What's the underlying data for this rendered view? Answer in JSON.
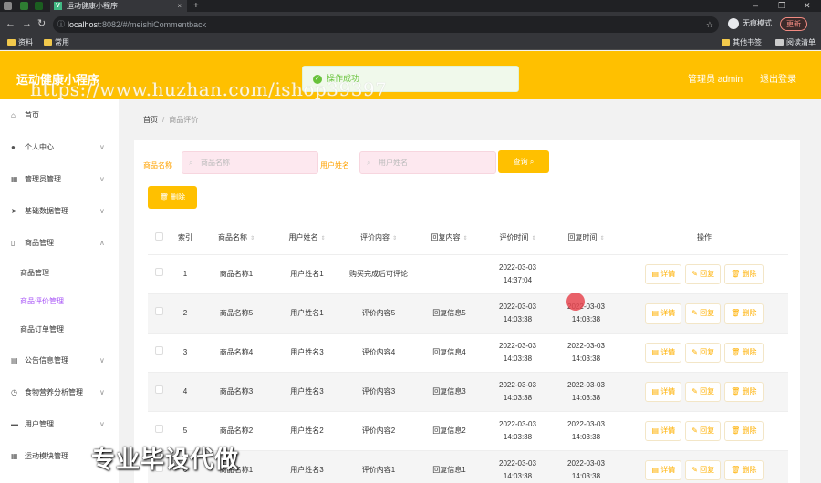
{
  "browser": {
    "tab_title": "运动健康小程序",
    "tab_favicon": "V",
    "url_host": "localhost",
    "url_rest": ":8082/#/meishiCommentback",
    "incognito_label": "无痕模式",
    "update_label": "更新",
    "bookmarks": [
      "资料",
      "常用"
    ],
    "bookmarks_right": [
      "其他书签",
      "阅读清单"
    ]
  },
  "header": {
    "title": "运动健康小程序",
    "toast": "操作成功",
    "admin_label": "管理员 admin",
    "logout_label": "退出登录",
    "watermark": "https://www.huzhan.com/ishop39397"
  },
  "sidebar": {
    "items": [
      {
        "label": "首页",
        "icon": "home-icon",
        "glyph": "⌂"
      },
      {
        "label": "个人中心",
        "icon": "user-icon",
        "glyph": "●",
        "chevron": "∨"
      },
      {
        "label": "管理员管理",
        "icon": "grid-icon",
        "glyph": "▦",
        "chevron": "∨"
      },
      {
        "label": "基础数据管理",
        "icon": "send-icon",
        "glyph": "➤",
        "chevron": "∨"
      },
      {
        "label": "商品管理",
        "icon": "phone-icon",
        "glyph": "▯",
        "chevron": "∧"
      }
    ],
    "sub_items": [
      "商品管理",
      "商品评价管理",
      "商品订单管理"
    ],
    "items_after": [
      {
        "label": "公告信息管理",
        "icon": "building-icon",
        "glyph": "▤",
        "chevron": "∨"
      },
      {
        "label": "食物营养分析管理",
        "icon": "clock-icon",
        "glyph": "◷",
        "chevron": "∨"
      },
      {
        "label": "用户管理",
        "icon": "chat-icon",
        "glyph": "▬",
        "chevron": "∨"
      },
      {
        "label": "运动模块管理",
        "icon": "apps-icon",
        "glyph": "▦",
        "chevron": "∨"
      }
    ]
  },
  "breadcrumb": {
    "home": "首页",
    "sep": "/",
    "current": "商品评价"
  },
  "filters": {
    "product_label": "商品名称",
    "product_placeholder": "商品名称",
    "user_label": "用户姓名",
    "user_placeholder": "用户姓名",
    "query_label": "查询 ⌕",
    "delete_label": "🗑 删除"
  },
  "table": {
    "headers": [
      "索引",
      "商品名称",
      "用户姓名",
      "评价内容",
      "回复内容",
      "评价时间",
      "回复时间",
      "操作"
    ],
    "actions": {
      "detail": "详情",
      "reply": "回复",
      "delete": "删除"
    },
    "rows": [
      {
        "index": "1",
        "product": "商品名称1",
        "user": "用户姓名1",
        "comment": "购买完成后可评论",
        "reply": "",
        "comment_time": "2022-03-03 14:37:04",
        "reply_time": ""
      },
      {
        "index": "2",
        "product": "商品名称5",
        "user": "用户姓名1",
        "comment": "评价内容5",
        "reply": "回复信息5",
        "comment_time": "2022-03-03 14:03:38",
        "reply_time": "2022-03-03 14:03:38"
      },
      {
        "index": "3",
        "product": "商品名称4",
        "user": "用户姓名3",
        "comment": "评价内容4",
        "reply": "回复信息4",
        "comment_time": "2022-03-03 14:03:38",
        "reply_time": "2022-03-03 14:03:38"
      },
      {
        "index": "4",
        "product": "商品名称3",
        "user": "用户姓名3",
        "comment": "评价内容3",
        "reply": "回复信息3",
        "comment_time": "2022-03-03 14:03:38",
        "reply_time": "2022-03-03 14:03:38"
      },
      {
        "index": "5",
        "product": "商品名称2",
        "user": "用户姓名2",
        "comment": "评价内容2",
        "reply": "回复信息2",
        "comment_time": "2022-03-03 14:03:38",
        "reply_time": "2022-03-03 14:03:38"
      },
      {
        "index": "6",
        "product": "商品名称1",
        "user": "用户姓名3",
        "comment": "评价内容1",
        "reply": "回复信息1",
        "comment_time": "2022-03-03 14:03:38",
        "reply_time": "2022-03-03 14:03:38"
      }
    ]
  },
  "overlay_text": "专业毕设代做",
  "colors": {
    "accent": "#ffc000",
    "active_submenu": "#a855f7",
    "success": "#67c23a"
  }
}
